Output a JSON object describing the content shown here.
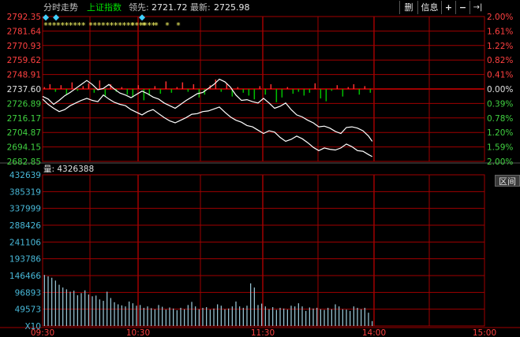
{
  "toolbar": {
    "view_label": "分时走势",
    "index_name": "上证指数",
    "leader_label": "领先:",
    "leader_value": "2721.72",
    "latest_label": "最新:",
    "latest_value": "2725.98",
    "buttons": [
      "删",
      "信息",
      "+",
      "−",
      "→|"
    ]
  },
  "price_axis_left": [
    "2792.35",
    "2781.64",
    "2770.93",
    "2759.62",
    "2748.91",
    "2737.60",
    "2726.89",
    "2716.17",
    "2704.87",
    "2694.15",
    "2682.85"
  ],
  "price_axis_right": [
    "2.00%",
    "1.61%",
    "1.22%",
    "0.82%",
    "0.41%",
    "0.00%",
    "0.39%",
    "0.78%",
    "1.20%",
    "1.59%",
    "2.00%"
  ],
  "volume_label": "量: 4326388",
  "volume_axis": [
    "432639",
    "385319",
    "337999",
    "288426",
    "241106",
    "193786",
    "146466",
    "96893",
    "49573",
    "X10"
  ],
  "time_axis": [
    "09:30",
    "10:30",
    "11:30",
    "14:00",
    "15:00"
  ],
  "interval_button": "区间",
  "colors": {
    "grid": "#a00000",
    "up": "#ff3030",
    "down": "#00c000",
    "price_line": "#ffffff",
    "leader_line": "#ffff66",
    "volume_bar": "#9fcfdf",
    "axis_text_cyan": "#48b8d8"
  },
  "chart_data": {
    "type": "line",
    "base_value": 2737.6,
    "ylim": [
      2682.85,
      2792.35
    ],
    "x_range_minutes": [
      0,
      240
    ],
    "series": [
      {
        "role": "price",
        "points": [
          [
            0,
            2730.0
          ],
          [
            3,
            2726.0
          ],
          [
            6,
            2723.0
          ],
          [
            9,
            2720.5
          ],
          [
            12,
            2722.0
          ],
          [
            15,
            2725.0
          ],
          [
            18,
            2727.0
          ],
          [
            21,
            2729.0
          ],
          [
            24,
            2730.5
          ],
          [
            27,
            2729.0
          ],
          [
            30,
            2728.0
          ],
          [
            33,
            2733.0
          ],
          [
            36,
            2730.0
          ],
          [
            39,
            2727.5
          ],
          [
            42,
            2726.0
          ],
          [
            45,
            2725.0
          ],
          [
            48,
            2722.0
          ],
          [
            51,
            2720.0
          ],
          [
            54,
            2718.0
          ],
          [
            57,
            2720.5
          ],
          [
            60,
            2722.0
          ],
          [
            63,
            2719.0
          ],
          [
            66,
            2716.0
          ],
          [
            69,
            2713.5
          ],
          [
            72,
            2712.0
          ],
          [
            75,
            2714.0
          ],
          [
            78,
            2716.0
          ],
          [
            81,
            2718.5
          ],
          [
            84,
            2719.0
          ],
          [
            87,
            2720.5
          ],
          [
            90,
            2721.0
          ],
          [
            93,
            2722.5
          ],
          [
            96,
            2724.0
          ],
          [
            99,
            2720.0
          ],
          [
            102,
            2716.5
          ],
          [
            105,
            2714.0
          ],
          [
            108,
            2712.5
          ],
          [
            111,
            2710.0
          ],
          [
            114,
            2709.0
          ],
          [
            117,
            2706.5
          ],
          [
            120,
            2704.0
          ],
          [
            123,
            2706.0
          ],
          [
            126,
            2705.0
          ],
          [
            129,
            2701.0
          ],
          [
            132,
            2698.0
          ],
          [
            135,
            2699.5
          ],
          [
            138,
            2702.0
          ],
          [
            141,
            2700.0
          ],
          [
            144,
            2697.0
          ],
          [
            147,
            2693.5
          ],
          [
            150,
            2691.0
          ],
          [
            153,
            2693.0
          ],
          [
            156,
            2692.0
          ],
          [
            159,
            2691.5
          ],
          [
            162,
            2693.0
          ],
          [
            165,
            2696.0
          ],
          [
            168,
            2694.0
          ],
          [
            171,
            2691.0
          ],
          [
            174,
            2690.5
          ],
          [
            177,
            2688.0
          ],
          [
            179,
            2686.5
          ]
        ]
      },
      {
        "role": "leader",
        "points": [
          [
            0,
            2732.0
          ],
          [
            3,
            2730.0
          ],
          [
            6,
            2726.0
          ],
          [
            9,
            2729.0
          ],
          [
            12,
            2732.5
          ],
          [
            15,
            2735.0
          ],
          [
            18,
            2738.0
          ],
          [
            21,
            2741.0
          ],
          [
            24,
            2744.0
          ],
          [
            27,
            2741.0
          ],
          [
            30,
            2737.0
          ],
          [
            33,
            2738.0
          ],
          [
            36,
            2741.0
          ],
          [
            39,
            2737.5
          ],
          [
            42,
            2734.5
          ],
          [
            45,
            2733.0
          ],
          [
            48,
            2731.0
          ],
          [
            51,
            2733.5
          ],
          [
            54,
            2736.0
          ],
          [
            57,
            2734.0
          ],
          [
            60,
            2731.5
          ],
          [
            63,
            2730.0
          ],
          [
            66,
            2727.0
          ],
          [
            69,
            2725.0
          ],
          [
            72,
            2723.0
          ],
          [
            75,
            2726.0
          ],
          [
            78,
            2729.0
          ],
          [
            81,
            2731.5
          ],
          [
            84,
            2734.0
          ],
          [
            87,
            2735.0
          ],
          [
            90,
            2738.0
          ],
          [
            93,
            2741.0
          ],
          [
            96,
            2745.0
          ],
          [
            99,
            2743.0
          ],
          [
            102,
            2739.0
          ],
          [
            105,
            2733.0
          ],
          [
            108,
            2729.0
          ],
          [
            111,
            2729.5
          ],
          [
            114,
            2728.0
          ],
          [
            117,
            2727.0
          ],
          [
            120,
            2730.5
          ],
          [
            123,
            2727.0
          ],
          [
            126,
            2723.0
          ],
          [
            129,
            2724.5
          ],
          [
            132,
            2727.0
          ],
          [
            135,
            2722.0
          ],
          [
            138,
            2718.0
          ],
          [
            141,
            2716.5
          ],
          [
            144,
            2714.0
          ],
          [
            147,
            2712.0
          ],
          [
            150,
            2709.0
          ],
          [
            153,
            2709.5
          ],
          [
            156,
            2708.0
          ],
          [
            159,
            2705.5
          ],
          [
            162,
            2704.0
          ],
          [
            165,
            2708.5
          ],
          [
            168,
            2709.0
          ],
          [
            171,
            2708.0
          ],
          [
            174,
            2706.0
          ],
          [
            177,
            2702.0
          ],
          [
            179,
            2698.0
          ]
        ]
      }
    ],
    "leader_bars_sample": [
      2,
      5,
      -3,
      4,
      -6,
      7,
      -2,
      3,
      6,
      -4,
      9,
      -8,
      5,
      -3,
      2,
      -6,
      -9,
      4,
      -12,
      -7,
      3,
      -5,
      8,
      -4,
      2,
      7,
      -3,
      5,
      -9,
      -6,
      4,
      10,
      -3,
      6,
      -8,
      2,
      -4,
      -7,
      -11,
      3,
      -6,
      5,
      -14,
      -9,
      2,
      -5,
      -3,
      -7,
      -4,
      6,
      -10,
      -13,
      -2,
      4,
      -8,
      2,
      5,
      -6,
      3,
      -4
    ],
    "volume_values": [
      1460000,
      1420000,
      1380000,
      1300000,
      1180000,
      1100000,
      1050000,
      980000,
      1010000,
      880000,
      940000,
      1020000,
      900000,
      850000,
      870000,
      760000,
      720000,
      980000,
      800000,
      680000,
      620000,
      590000,
      560000,
      700000,
      650000,
      580000,
      600000,
      520000,
      560000,
      510000,
      480000,
      600000,
      550000,
      470000,
      530000,
      500000,
      450000,
      520000,
      480000,
      600000,
      690000,
      560000,
      480000,
      520000,
      540000,
      470000,
      500000,
      620000,
      580000,
      480000,
      500000,
      560000,
      700000,
      560000,
      520000,
      580000,
      1220000,
      1100000,
      600000,
      640000,
      560000,
      480000,
      540000,
      460000,
      520000,
      500000,
      470000,
      580000,
      560000,
      650000,
      560000,
      430000,
      530000,
      500000,
      520000,
      480000,
      460000,
      520000,
      480000,
      620000,
      560000,
      480000,
      470000,
      430000,
      560000,
      520000,
      480000,
      520000,
      380000,
      140000
    ]
  }
}
